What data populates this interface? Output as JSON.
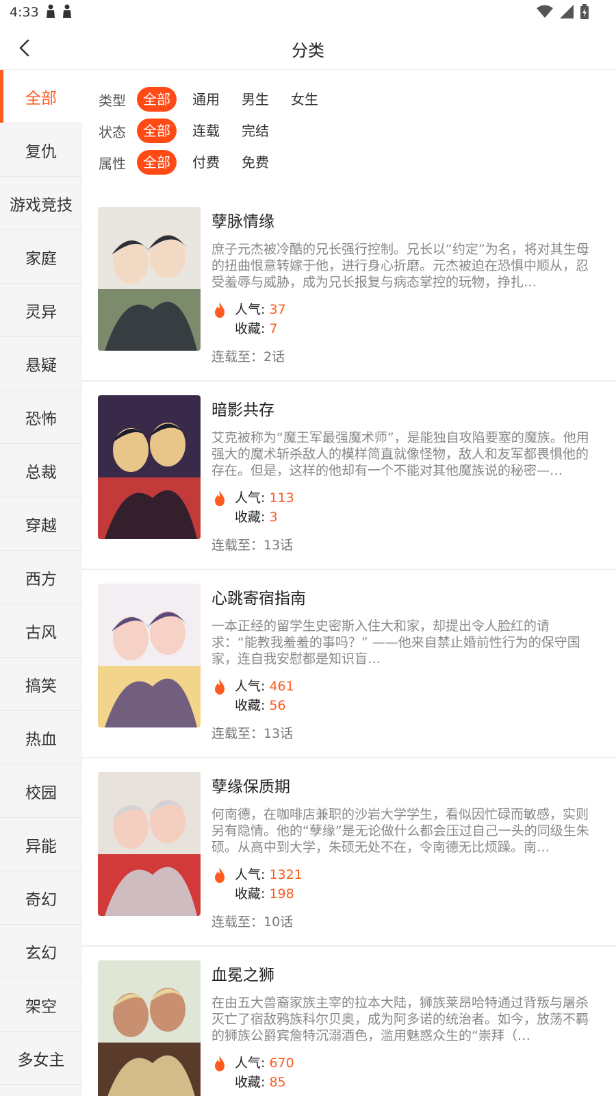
{
  "status_bar": {
    "time": "4:33",
    "left_icons": [
      "notification-icon",
      "notification-icon"
    ],
    "right_icons": [
      "wifi-icon",
      "signal-icon",
      "battery-icon"
    ]
  },
  "header": {
    "title": "分类",
    "back_icon": "chevron-left-icon"
  },
  "sidebar": {
    "items": [
      {
        "label": "全部",
        "active": true
      },
      {
        "label": "复仇"
      },
      {
        "label": "游戏竞技"
      },
      {
        "label": "家庭"
      },
      {
        "label": "灵异"
      },
      {
        "label": "悬疑"
      },
      {
        "label": "恐怖"
      },
      {
        "label": "总裁"
      },
      {
        "label": "穿越"
      },
      {
        "label": "西方"
      },
      {
        "label": "古风"
      },
      {
        "label": "搞笑"
      },
      {
        "label": "热血"
      },
      {
        "label": "校园"
      },
      {
        "label": "异能"
      },
      {
        "label": "奇幻"
      },
      {
        "label": "玄幻"
      },
      {
        "label": "架空"
      },
      {
        "label": "多女主"
      }
    ]
  },
  "filters": [
    {
      "label": "类型",
      "options": [
        "全部",
        "通用",
        "男生",
        "女生"
      ],
      "selected": 0
    },
    {
      "label": "状态",
      "options": [
        "全部",
        "连载",
        "完结"
      ],
      "selected": 0
    },
    {
      "label": "属性",
      "options": [
        "全部",
        "付费",
        "免费"
      ],
      "selected": 0
    }
  ],
  "stat_labels": {
    "popularity": "人气: ",
    "favorites": "收藏: "
  },
  "books": [
    {
      "title": "孽脉情缘",
      "desc": "庶子元杰被冷酷的兄长强行控制。兄长以“约定”为名，将对其生母的扭曲恨意转嫁于他，进行身心折磨。元杰被迫在恐惧中顺从，忍受羞辱与威胁，成为兄长报复与病态掌控的玩物，挣扎…",
      "popularity": "37",
      "favorites": "7",
      "serial": "连载至：2话"
    },
    {
      "title": "暗影共存",
      "desc": "艾克被称为“魔王军最强魔术师”，是能独自攻陷要塞的魔族。他用强大的魔术斩杀敌人的模样简直就像怪物，敌人和友军都畏惧他的存在。但是，这样的他却有一个不能对其他魔族说的秘密—…",
      "popularity": "113",
      "favorites": "3",
      "serial": "连载至：13话"
    },
    {
      "title": "心跳寄宿指南",
      "desc": "一本正经的留学生史密斯入住大和家，却提出令人脸红的请求：“能教我羞羞的事吗？” ——他来自禁止婚前性行为的保守国家，连自我安慰都是知识盲…",
      "popularity": "461",
      "favorites": "56",
      "serial": "连载至：13话"
    },
    {
      "title": "孽缘保质期",
      "desc": "何南德，在咖啡店兼职的沙岩大学学生，看似因忙碌而敏感，实则另有隐情。他的“孽缘”是无论做什么都会压过自己一头的同级生朱硕。从高中到大学，朱硕无处不在，令南德无比烦躁。南…",
      "popularity": "1321",
      "favorites": "198",
      "serial": "连载至：10话"
    },
    {
      "title": "血冕之狮",
      "desc": "在由五大兽裔家族主宰的拉本大陆，狮族莱昂哈特通过背叛与屠杀灭亡了宿敌鸦族科尔贝奥，成为阿多诺的统治者。如今，放荡不羁的狮族公爵宾詹特沉溺酒色，滥用魅惑众生的“崇拜（…",
      "popularity": "670",
      "favorites": "85",
      "serial": ""
    }
  ],
  "colors": {
    "accent": "#ff4a16",
    "sidebar_bg": "#f5f5f5"
  }
}
